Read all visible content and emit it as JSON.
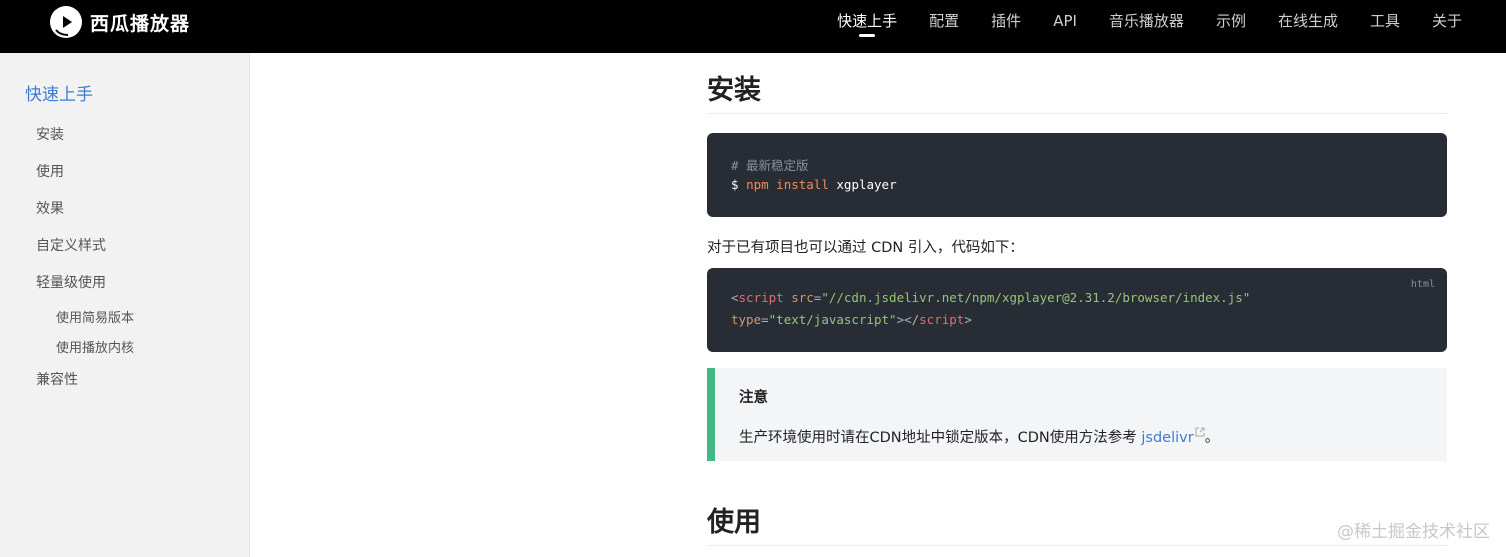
{
  "brand": {
    "name": "西瓜播放器",
    "logo_icon": "xigua-logo-icon"
  },
  "nav": {
    "items": [
      {
        "label": "快速上手",
        "active": true
      },
      {
        "label": "配置"
      },
      {
        "label": "插件"
      },
      {
        "label": "API"
      },
      {
        "label": "音乐播放器"
      },
      {
        "label": "示例"
      },
      {
        "label": "在线生成"
      },
      {
        "label": "工具"
      },
      {
        "label": "关于"
      }
    ]
  },
  "sidebar": {
    "title": "快速上手",
    "items": [
      "安装",
      "使用",
      "效果",
      "自定义样式",
      "轻量级使用"
    ],
    "subitems": [
      "使用简易版本",
      "使用播放内核"
    ],
    "last_item": "兼容性"
  },
  "main": {
    "section1_title": "安装",
    "code1": {
      "comment": "# 最新稳定版",
      "prompt": "$",
      "cmd": "npm",
      "sub": "install",
      "pkg": "xgplayer"
    },
    "cdn_text": "对于已有项目也可以通过 CDN 引入，代码如下：",
    "code2": {
      "lang": "html",
      "open_bracket": "<",
      "tag": "script",
      "attr_src": "src",
      "eq": "=",
      "src_value": "\"//cdn.jsdelivr.net/npm/xgplayer@2.31.2/browser/index.js\"",
      "attr_type": "type",
      "type_value": "\"text/javascript\"",
      "close_mid": "></",
      "close_end": ">"
    },
    "tip": {
      "title": "注意",
      "text": "生产环境使用时请在CDN地址中锁定版本，CDN使用方法参考 ",
      "link": "jsdelivr",
      "end": "。"
    },
    "section2_title": "使用"
  },
  "watermark": "@稀土掘金技术社区",
  "colors": {
    "accent": "#3e7bd6",
    "tip_border": "#42b983",
    "code_bg": "#282c34",
    "topbar": "#000000"
  }
}
